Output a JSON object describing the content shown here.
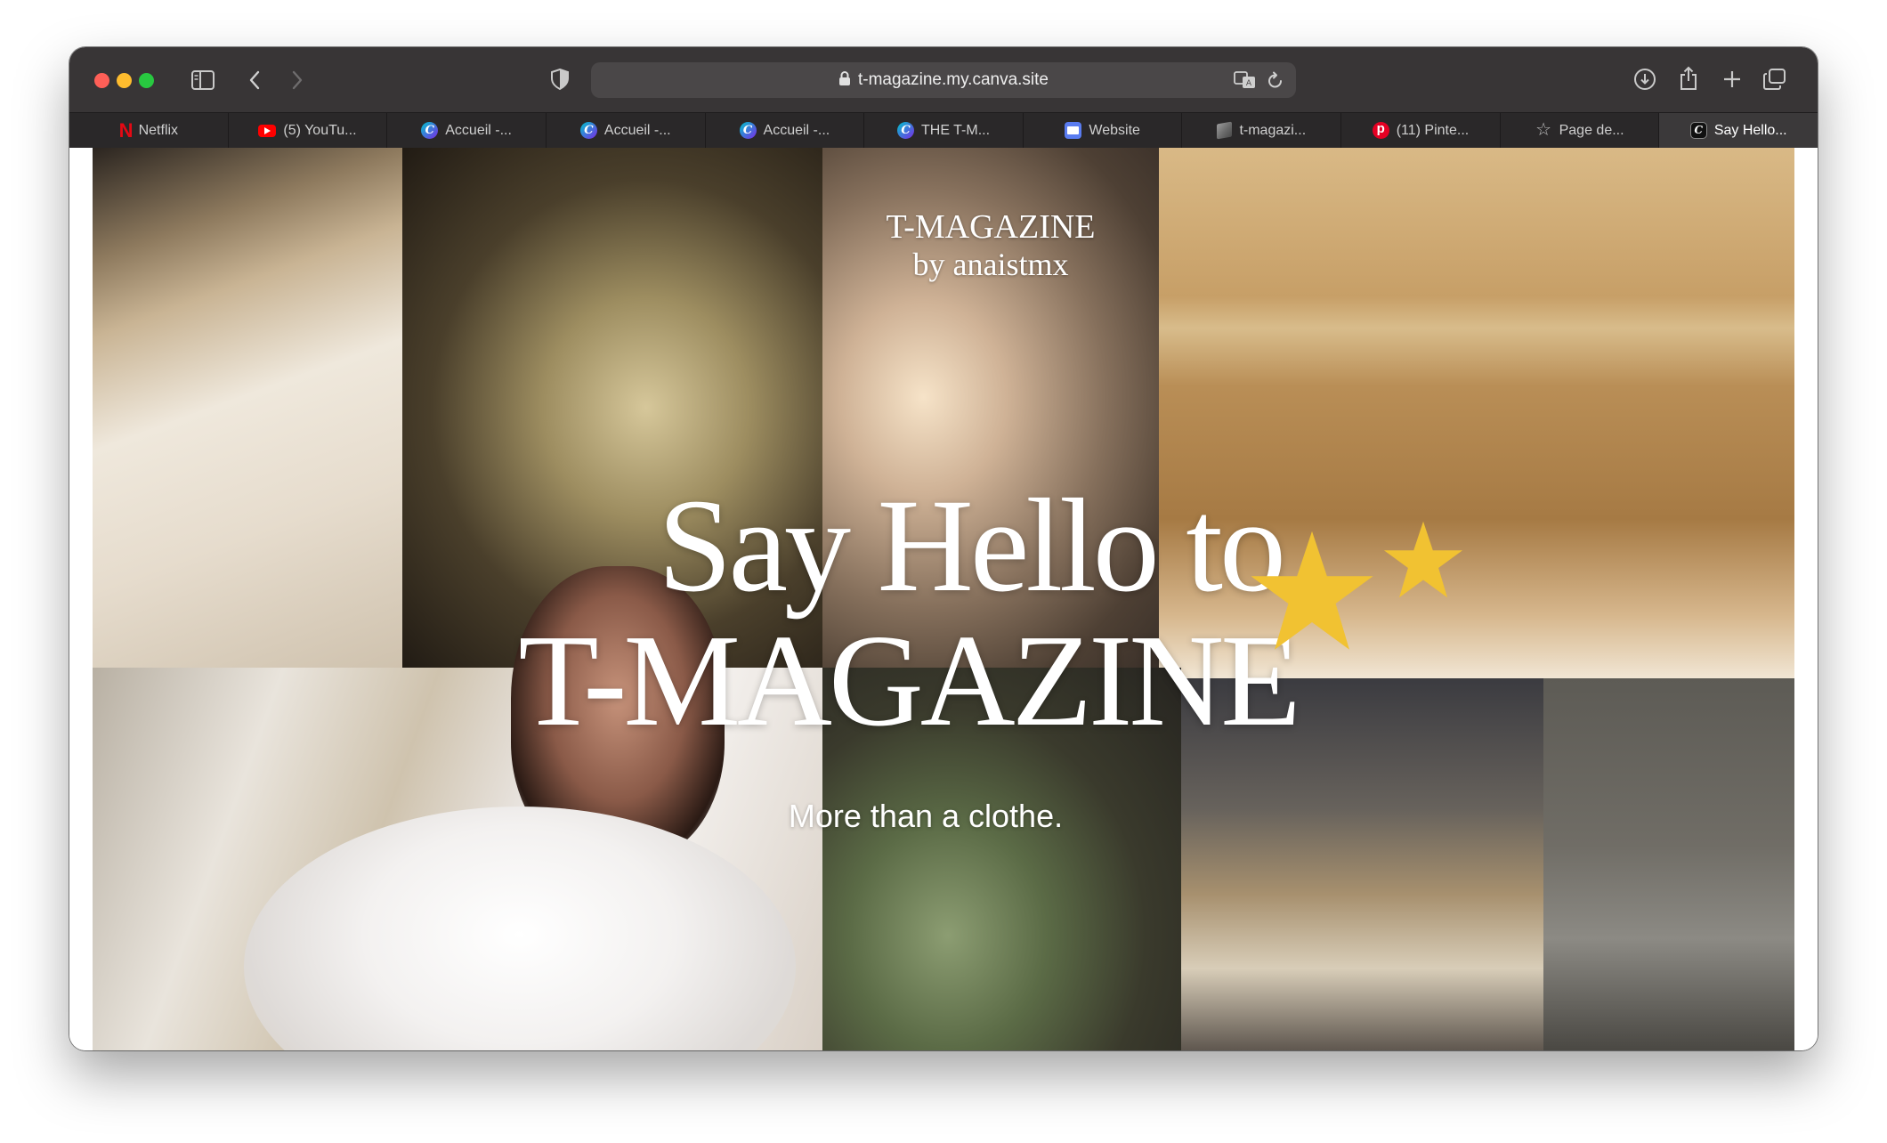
{
  "browser": {
    "url": "t-magazine.my.canva.site",
    "tabs": [
      {
        "label": "Netflix",
        "icon": "netflix-icon"
      },
      {
        "label": "(5) YouTu...",
        "icon": "youtube-icon"
      },
      {
        "label": "Accueil -...",
        "icon": "canva-icon"
      },
      {
        "label": "Accueil -...",
        "icon": "canva-icon"
      },
      {
        "label": "Accueil -...",
        "icon": "canva-icon"
      },
      {
        "label": "THE T-M...",
        "icon": "canva-icon"
      },
      {
        "label": "Website",
        "icon": "website-icon"
      },
      {
        "label": "t-magazi...",
        "icon": "box-icon"
      },
      {
        "label": "(11) Pinte...",
        "icon": "pinterest-icon"
      },
      {
        "label": "Page de...",
        "icon": "star-icon"
      },
      {
        "label": "Say Hello...",
        "icon": "canva-dark-icon",
        "active": true
      }
    ]
  },
  "hero": {
    "brand_title": "T-MAGAZINE",
    "brand_subtitle": "by anaistmx",
    "headline_line1": "Say Hello to",
    "headline_line2": "T-MAGAZINE",
    "tagline": "More than a clothe."
  },
  "colors": {
    "star": "#f1c232",
    "titlebar": "#383536"
  }
}
